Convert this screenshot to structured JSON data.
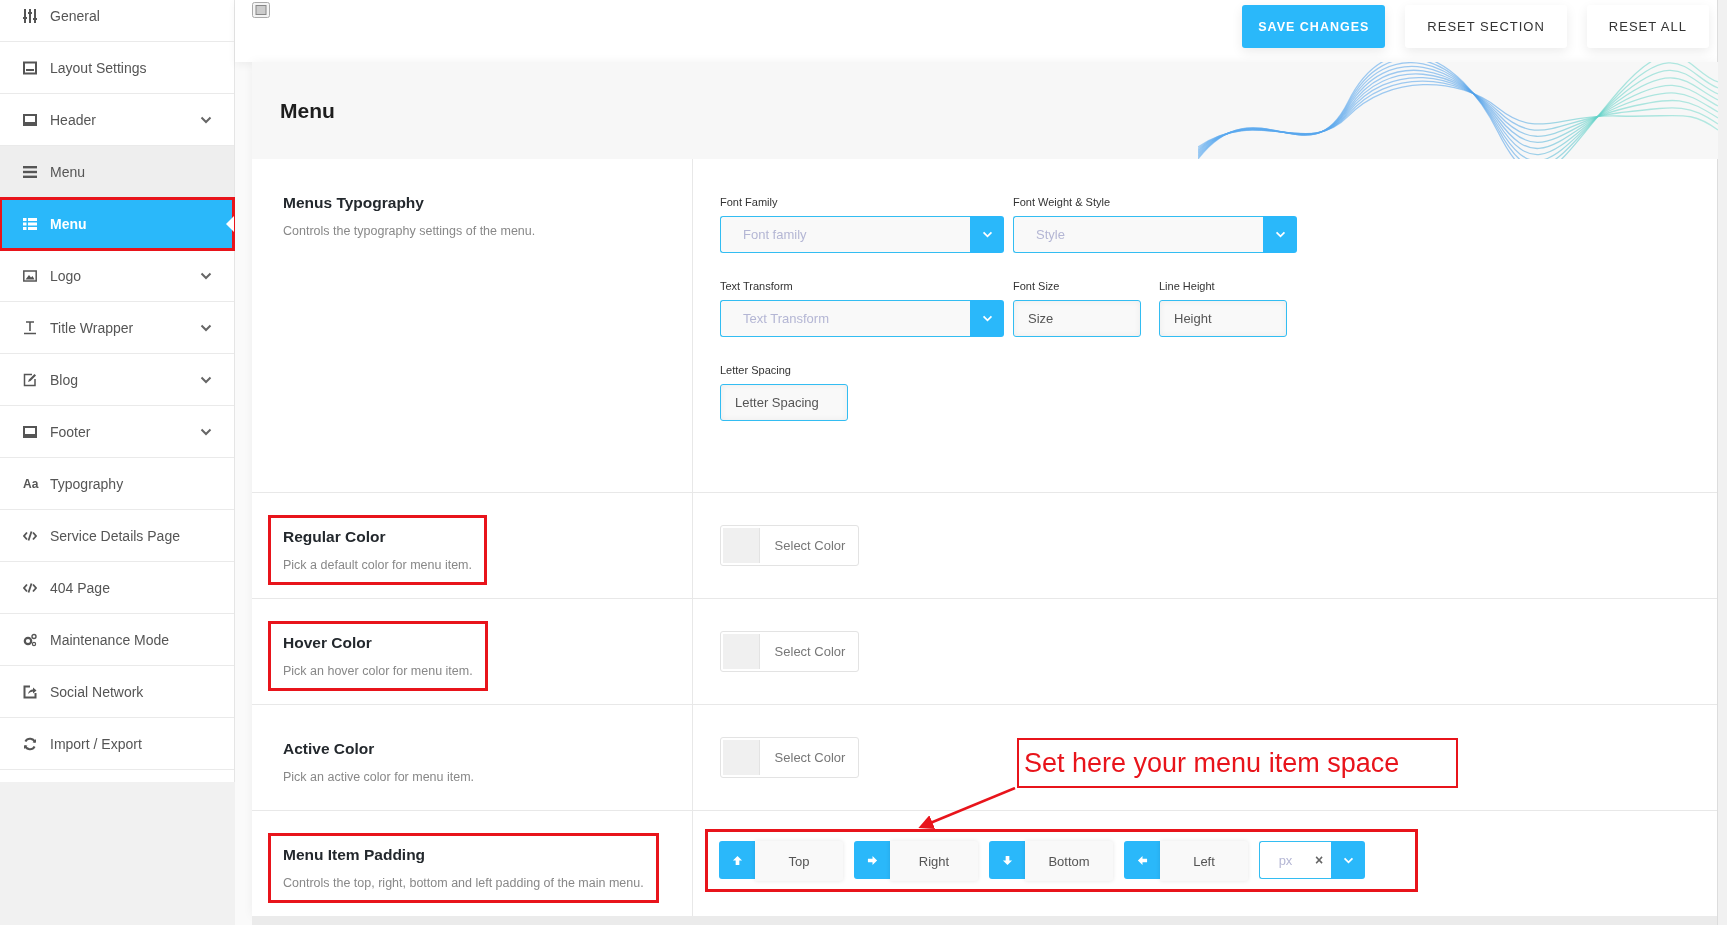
{
  "sidebar": {
    "items": [
      {
        "label": "General",
        "has_children": false,
        "expanded": false,
        "selected": false,
        "highlighted": false
      },
      {
        "label": "Layout Settings",
        "has_children": false,
        "expanded": false,
        "selected": false,
        "highlighted": false
      },
      {
        "label": "Header",
        "has_children": true,
        "expanded": false,
        "selected": false,
        "highlighted": false
      },
      {
        "label": "Menu",
        "has_children": true,
        "expanded": true,
        "selected": false,
        "highlighted": false
      },
      {
        "label": "Menu",
        "has_children": false,
        "expanded": false,
        "selected": true,
        "highlighted": true
      },
      {
        "label": "Logo",
        "has_children": true,
        "expanded": false,
        "selected": false,
        "highlighted": false
      },
      {
        "label": "Title Wrapper",
        "has_children": true,
        "expanded": false,
        "selected": false,
        "highlighted": false
      },
      {
        "label": "Blog",
        "has_children": true,
        "expanded": false,
        "selected": false,
        "highlighted": false
      },
      {
        "label": "Footer",
        "has_children": true,
        "expanded": false,
        "selected": false,
        "highlighted": false
      },
      {
        "label": "Typography",
        "glyph": "Aa",
        "has_children": false,
        "expanded": false,
        "selected": false,
        "highlighted": false
      },
      {
        "label": "Service Details Page",
        "has_children": false,
        "expanded": false,
        "selected": false,
        "highlighted": false
      },
      {
        "label": "404 Page",
        "has_children": false,
        "expanded": false,
        "selected": false,
        "highlighted": false
      },
      {
        "label": "Maintenance Mode",
        "has_children": false,
        "expanded": false,
        "selected": false,
        "highlighted": false
      },
      {
        "label": "Social Network",
        "has_children": false,
        "expanded": false,
        "selected": false,
        "highlighted": false
      },
      {
        "label": "Import / Export",
        "has_children": false,
        "expanded": false,
        "selected": false,
        "highlighted": false
      }
    ]
  },
  "toolbar": {
    "buttons": [
      {
        "label": "SAVE CHANGES",
        "kind": "primary"
      },
      {
        "label": "RESET SECTION",
        "kind": "secondary"
      },
      {
        "label": "RESET ALL",
        "kind": "secondary"
      }
    ]
  },
  "panel": {
    "title": "Menu",
    "sections": [
      {
        "kind": "typography",
        "title": "Menus Typography",
        "description": "Controls the typography settings of the menu.",
        "highlighted": false,
        "rows": [
          [
            {
              "kind": "select",
              "label": "Font Family",
              "placeholder": "Font family"
            },
            {
              "kind": "select",
              "label": "Font Weight & Style",
              "placeholder": "Style"
            }
          ],
          [
            {
              "kind": "select",
              "label": "Text Transform",
              "placeholder": "Text Transform"
            },
            {
              "kind": "input",
              "label": "Font Size",
              "placeholder": "Size"
            },
            {
              "kind": "input",
              "label": "Line Height",
              "placeholder": "Height"
            }
          ],
          [
            {
              "kind": "input",
              "label": "Letter Spacing",
              "placeholder": "Letter Spacing"
            }
          ]
        ]
      },
      {
        "kind": "color",
        "title": "Regular Color",
        "description": "Pick a default color for menu item.",
        "highlighted": true,
        "button": "Select Color"
      },
      {
        "kind": "color",
        "title": "Hover Color",
        "description": "Pick an hover color for menu item.",
        "highlighted": true,
        "button": "Select Color"
      },
      {
        "kind": "color",
        "title": "Active Color",
        "description": "Pick an active color for menu item.",
        "highlighted": false,
        "button": "Select Color"
      },
      {
        "kind": "spacing",
        "title": "Menu Item Padding",
        "description": "Controls the top, right, bottom and left padding of the main menu.",
        "highlighted": true,
        "controls_highlighted": true,
        "fields": [
          {
            "kind": "up",
            "placeholder": "Top"
          },
          {
            "kind": "right",
            "placeholder": "Right"
          },
          {
            "kind": "down",
            "placeholder": "Bottom"
          },
          {
            "kind": "left",
            "placeholder": "Left"
          }
        ],
        "unit": {
          "placeholder": "px",
          "clear": "×"
        }
      }
    ]
  },
  "callout": {
    "text": "Set here your menu item space"
  }
}
